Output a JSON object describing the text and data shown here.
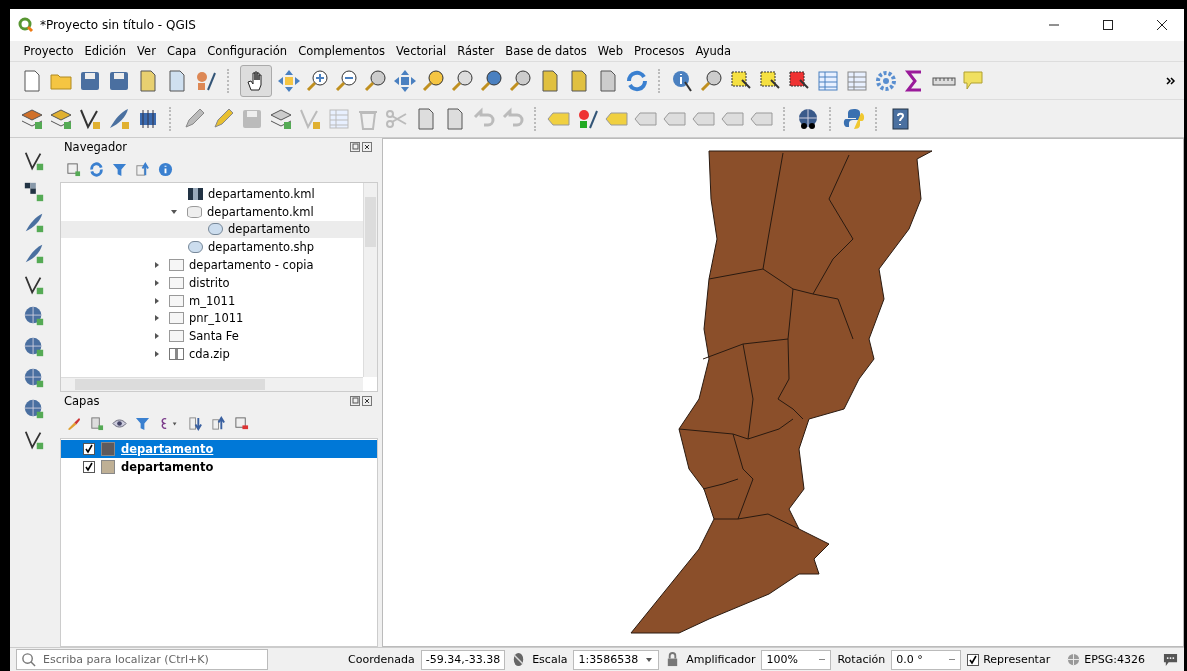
{
  "window": {
    "title": "*Proyecto sin título - QGIS"
  },
  "menu": [
    "Proyecto",
    "Edición",
    "Ver",
    "Capa",
    "Configuración",
    "Complementos",
    "Vectorial",
    "Ráster",
    "Base de datos",
    "Web",
    "Procesos",
    "Ayuda"
  ],
  "navigator": {
    "title": "Navegador",
    "tree": [
      {
        "children": [
          {
            "label": "departamento.kml",
            "kind": "raster",
            "selected": false
          },
          {
            "label": "departamento.kml",
            "kind": "database",
            "selected": false,
            "expanded": true,
            "children": [
              {
                "label": "departamento",
                "kind": "polygon",
                "selected": true
              }
            ]
          },
          {
            "label": "departamento.shp",
            "kind": "polygon",
            "selected": false
          }
        ]
      },
      {
        "label": "departamento - copia",
        "kind": "folder",
        "selected": false,
        "expanded": false
      },
      {
        "label": "distrito",
        "kind": "folder",
        "selected": false,
        "expanded": false
      },
      {
        "label": "m_1011",
        "kind": "folder",
        "selected": false,
        "expanded": false
      },
      {
        "label": "pnr_1011",
        "kind": "folder",
        "selected": false,
        "expanded": false
      },
      {
        "label": "Santa Fe",
        "kind": "folder",
        "selected": false,
        "expanded": false
      },
      {
        "label": "cda.zip",
        "kind": "zip",
        "selected": false,
        "expanded": false
      }
    ]
  },
  "layers": {
    "title": "Capas",
    "items": [
      {
        "name": "departamento",
        "checked": true,
        "selected": true,
        "color": "#5f5a5c"
      },
      {
        "name": "departamento",
        "checked": true,
        "selected": false,
        "color": "#bfb095"
      }
    ]
  },
  "status_bar": {
    "search_placeholder": "Escriba para localizar (Ctrl+K)",
    "coordinate_label": "Coordenada",
    "coordinate": "-59.34,-33.38",
    "scale_label": "Escala",
    "scale": "1:3586538",
    "magnifier_label": "Amplificador",
    "magnifier": "100%",
    "rotation_label": "Rotación",
    "rotation": "0.0 °",
    "render_label": "Representar",
    "render_checked": true,
    "crs": "EPSG:4326"
  }
}
